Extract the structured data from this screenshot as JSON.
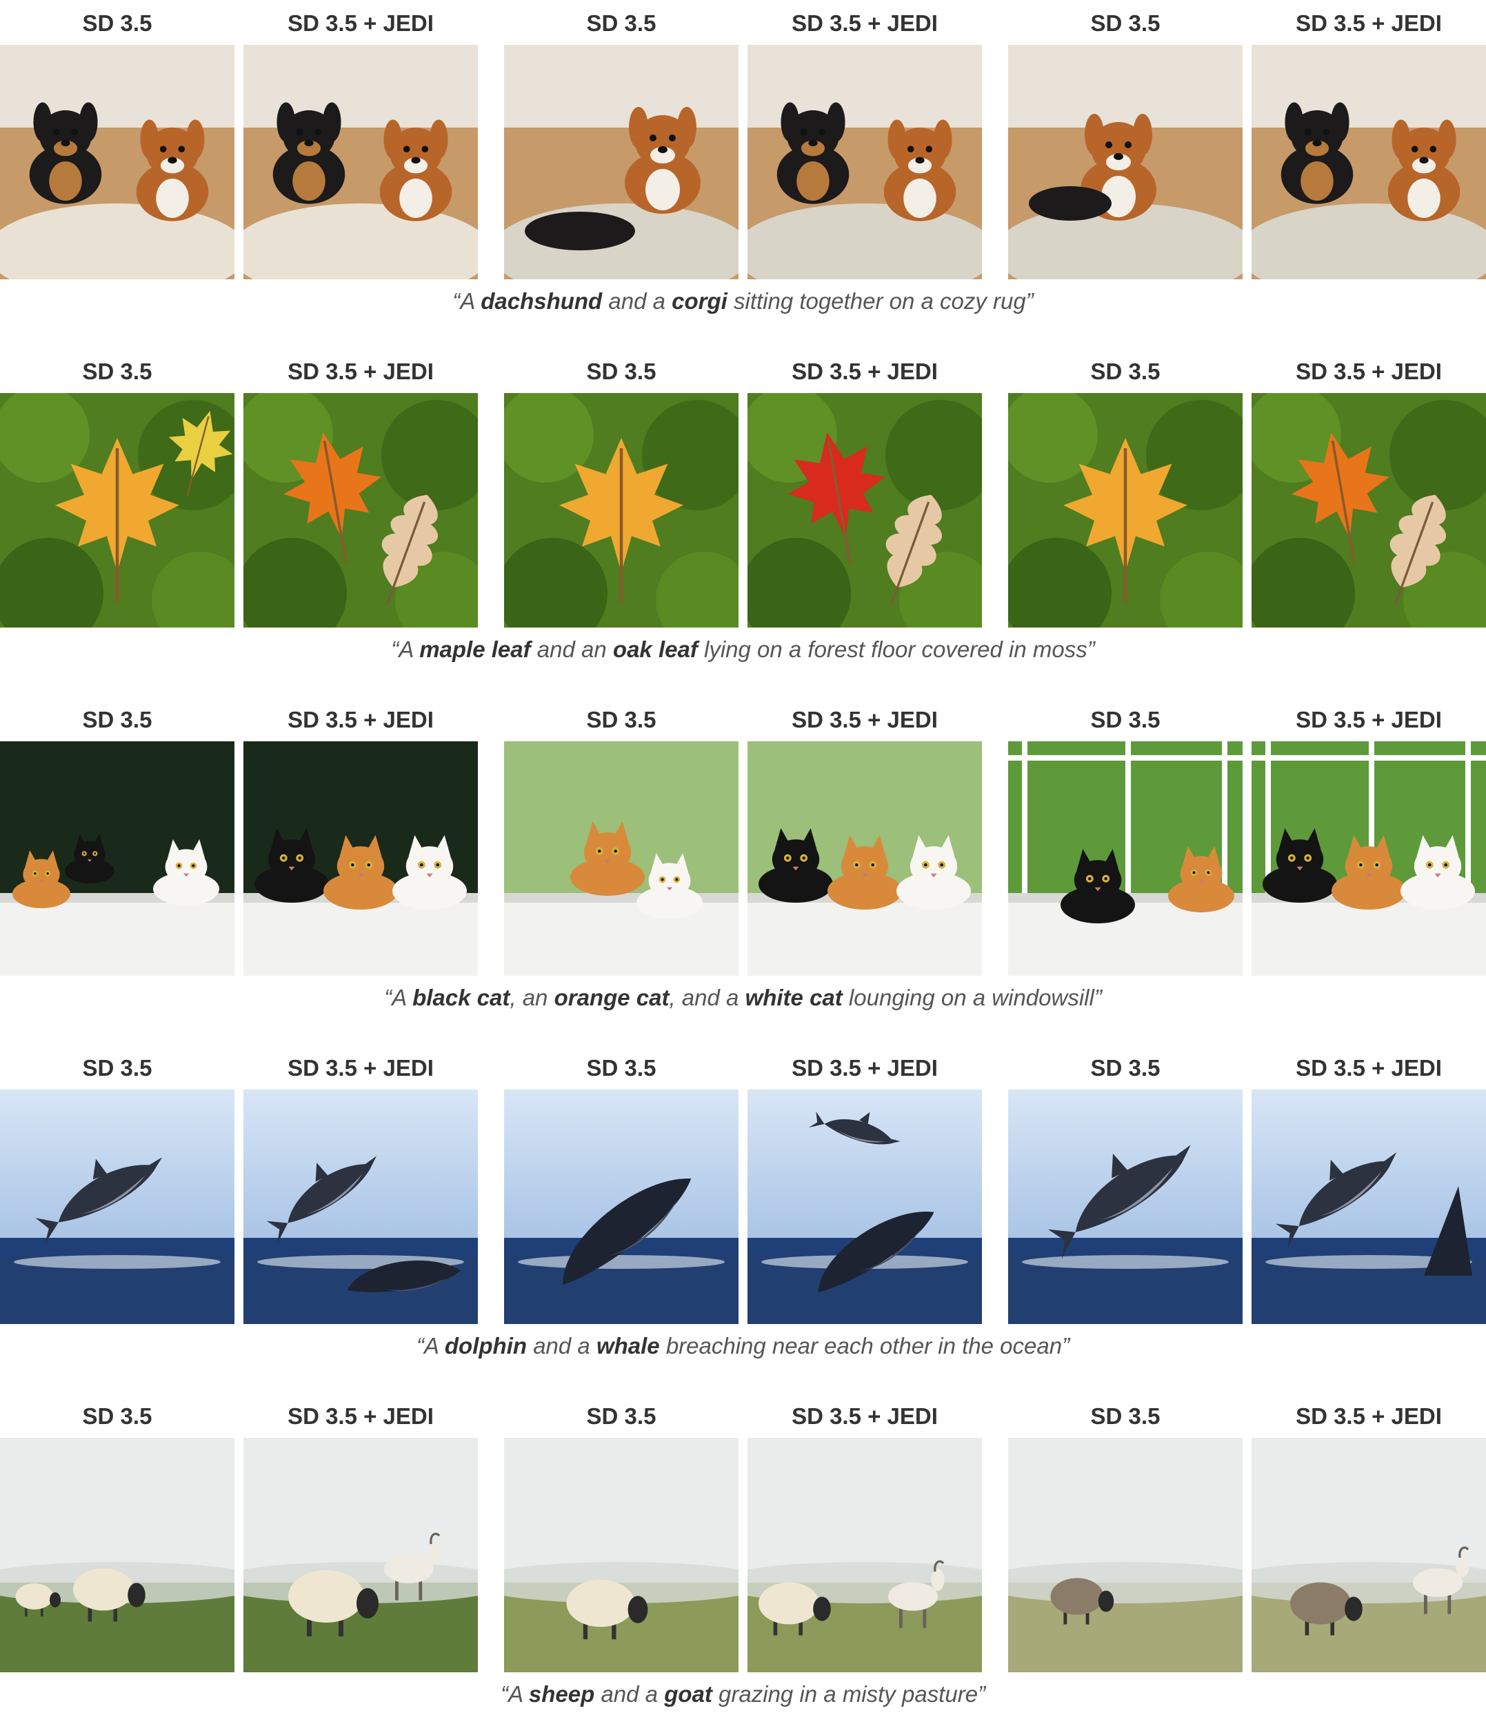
{
  "figure": {
    "column_labels": [
      "SD 3.5",
      "SD 3.5 + JEDI",
      "SD 3.5",
      "SD 3.5 + JEDI",
      "SD 3.5",
      "SD 3.5 + JEDI"
    ],
    "rows": [
      {
        "theme": "dogs",
        "caption": [
          {
            "text": "“A ",
            "bold": false
          },
          {
            "text": "dachshund",
            "bold": true
          },
          {
            "text": " and a ",
            "bold": false
          },
          {
            "text": "corgi",
            "bold": true
          },
          {
            "text": " sitting together on a cozy rug”",
            "bold": false
          }
        ]
      },
      {
        "theme": "leaves",
        "caption": [
          {
            "text": "“A ",
            "bold": false
          },
          {
            "text": "maple leaf",
            "bold": true
          },
          {
            "text": " and an ",
            "bold": false
          },
          {
            "text": "oak leaf",
            "bold": true
          },
          {
            "text": " lying on a forest floor covered in moss”",
            "bold": false
          }
        ]
      },
      {
        "theme": "cats",
        "caption": [
          {
            "text": "“A ",
            "bold": false
          },
          {
            "text": "black cat",
            "bold": true
          },
          {
            "text": ", an ",
            "bold": false
          },
          {
            "text": "orange cat",
            "bold": true
          },
          {
            "text": ", and a ",
            "bold": false
          },
          {
            "text": "white cat",
            "bold": true
          },
          {
            "text": " lounging on a windowsill”",
            "bold": false
          }
        ]
      },
      {
        "theme": "ocean",
        "caption": [
          {
            "text": "“A ",
            "bold": false
          },
          {
            "text": "dolphin",
            "bold": true
          },
          {
            "text": " and a ",
            "bold": false
          },
          {
            "text": "whale",
            "bold": true
          },
          {
            "text": " breaching near each other in the ocean”",
            "bold": false
          }
        ]
      },
      {
        "theme": "pasture",
        "caption": [
          {
            "text": "“A ",
            "bold": false
          },
          {
            "text": "sheep",
            "bold": true
          },
          {
            "text": " and a ",
            "bold": false
          },
          {
            "text": "goat",
            "bold": true
          },
          {
            "text": " grazing in a misty pasture”",
            "bold": false
          }
        ]
      }
    ]
  },
  "colors": {
    "label_text": "#333333",
    "caption_text": "#555555",
    "moss": "#4f7d1f",
    "sea": "#1f3f78",
    "sky": "#bcd3ee",
    "mist": "#e9eceb"
  }
}
